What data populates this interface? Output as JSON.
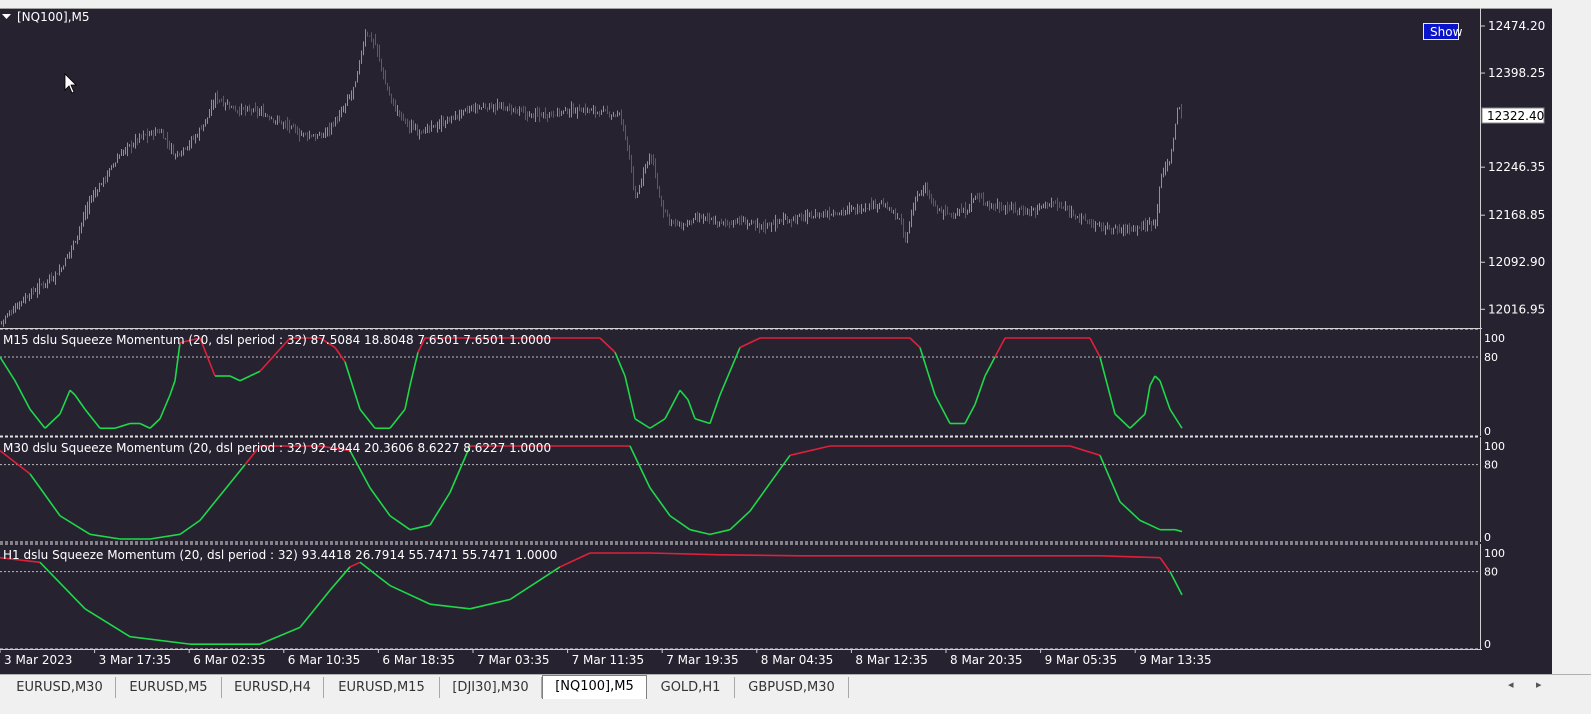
{
  "chart": {
    "symbol_label": "[NQ100],M5",
    "show_button_label": "Show",
    "current_price_label": "12322.40",
    "colors": {
      "background": "#262230",
      "bull": "#1ed94a",
      "bear": "#e0203a",
      "grid_dash": "#c8c8c8",
      "text": "#ffffff"
    },
    "price_axis_labels": [
      "12474.20",
      "12398.25",
      "12246.35",
      "12168.85",
      "12092.90",
      "12016.95"
    ],
    "time_axis_labels": [
      "3 Mar 2023",
      "3 Mar 17:35",
      "6 Mar 02:35",
      "6 Mar 10:35",
      "6 Mar 18:35",
      "7 Mar 03:35",
      "7 Mar 11:35",
      "7 Mar 19:35",
      "8 Mar 04:35",
      "8 Mar 12:35",
      "8 Mar 20:35",
      "9 Mar 05:35",
      "9 Mar 13:35"
    ]
  },
  "indicators": [
    {
      "label": "M15 dslu Squeeze Momentum (20, dsl period : 32) 87.5084 18.8048 7.6501 7.6501 1.0000",
      "levels": [
        "100",
        "80",
        "0"
      ]
    },
    {
      "label": "M30 dslu Squeeze Momentum (20, dsl period : 32) 92.4944 20.3606 8.6227 8.6227 1.0000",
      "levels": [
        "100",
        "80",
        "0"
      ]
    },
    {
      "label": "H1 dslu Squeeze Momentum (20, dsl period : 32) 93.4418 26.7914 55.7471 55.7471 1.0000",
      "levels": [
        "100",
        "80",
        "0"
      ]
    }
  ],
  "tabs": [
    "EURUSD,M30",
    "EURUSD,M5",
    "EURUSD,H4",
    "EURUSD,M15",
    "[DJI30],M30",
    "[NQ100],M5",
    "GOLD,H1",
    "GBPUSD,M30"
  ],
  "active_tab": "[NQ100],M5",
  "tab_nav": {
    "left": "◂",
    "right": "▸"
  },
  "chart_data": {
    "type": "line",
    "title": "[NQ100],M5",
    "x_labels": [
      "3 Mar 2023",
      "3 Mar 17:35",
      "6 Mar 02:35",
      "6 Mar 10:35",
      "6 Mar 18:35",
      "7 Mar 03:35",
      "7 Mar 11:35",
      "7 Mar 19:35",
      "8 Mar 04:35",
      "8 Mar 12:35",
      "8 Mar 20:35",
      "9 Mar 05:35",
      "9 Mar 13:35"
    ],
    "ylim": [
      11990,
      12500
    ],
    "price_series": {
      "name": "[NQ100],M5",
      "x": [
        0,
        20,
        40,
        60,
        75,
        90,
        105,
        120,
        140,
        160,
        175,
        195,
        210,
        215,
        235,
        260,
        285,
        300,
        320,
        340,
        355,
        365,
        375,
        385,
        395,
        410,
        425,
        445,
        470,
        490,
        510,
        530,
        560,
        580,
        600,
        620,
        630,
        634,
        640,
        650,
        660,
        670,
        680,
        700,
        720,
        740,
        760,
        780,
        800,
        820,
        840,
        860,
        880,
        900,
        905,
        915,
        925,
        935,
        950,
        965,
        975,
        990,
        1010,
        1030,
        1050,
        1070,
        1085,
        1100,
        1120,
        1140,
        1155,
        1160,
        1170,
        1178,
        1182
      ],
      "values": [
        11995,
        12030,
        12055,
        12080,
        12130,
        12195,
        12230,
        12268,
        12295,
        12305,
        12265,
        12295,
        12335,
        12360,
        12340,
        12335,
        12315,
        12300,
        12295,
        12330,
        12380,
        12465,
        12445,
        12380,
        12340,
        12310,
        12305,
        12320,
        12340,
        12345,
        12340,
        12330,
        12335,
        12340,
        12335,
        12330,
        12260,
        12190,
        12220,
        12270,
        12190,
        12160,
        12150,
        12165,
        12155,
        12160,
        12150,
        12160,
        12165,
        12170,
        12175,
        12180,
        12190,
        12160,
        12125,
        12200,
        12210,
        12180,
        12170,
        12175,
        12200,
        12185,
        12180,
        12175,
        12190,
        12175,
        12160,
        12150,
        12145,
        12150,
        12160,
        12230,
        12260,
        12350,
        12322
      ]
    },
    "series": [
      {
        "name": "M15",
        "ylim": [
          0,
          100
        ],
        "x": [
          0,
          15,
          30,
          45,
          60,
          70,
          75,
          85,
          100,
          115,
          130,
          140,
          150,
          160,
          170,
          175,
          180,
          200,
          215,
          230,
          240,
          250,
          260,
          290,
          320,
          335,
          345,
          360,
          375,
          390,
          405,
          410,
          418,
          425,
          440,
          480,
          520,
          560,
          600,
          615,
          625,
          635,
          650,
          665,
          680,
          688,
          695,
          710,
          720,
          728,
          740,
          760,
          800,
          840,
          880,
          910,
          920,
          935,
          950,
          965,
          975,
          985,
          995,
          1005,
          1050,
          1090,
          1100,
          1115,
          1130,
          1145,
          1150,
          1155,
          1160,
          1170,
          1182
        ],
        "values": [
          80,
          55,
          25,
          5,
          20,
          45,
          40,
          25,
          5,
          5,
          10,
          10,
          5,
          15,
          40,
          55,
          95,
          100,
          60,
          60,
          55,
          60,
          65,
          100,
          100,
          90,
          75,
          25,
          5,
          5,
          25,
          50,
          85,
          100,
          100,
          100,
          100,
          100,
          100,
          85,
          60,
          15,
          5,
          15,
          45,
          35,
          15,
          10,
          40,
          60,
          90,
          100,
          100,
          100,
          100,
          100,
          90,
          40,
          10,
          10,
          30,
          60,
          80,
          100,
          100,
          100,
          80,
          20,
          5,
          20,
          50,
          60,
          55,
          25,
          5
        ]
      },
      {
        "name": "M30",
        "ylim": [
          0,
          100
        ],
        "x": [
          0,
          30,
          60,
          90,
          120,
          150,
          180,
          200,
          215,
          230,
          245,
          260,
          290,
          320,
          350,
          370,
          390,
          410,
          430,
          450,
          470,
          500,
          540,
          580,
          630,
          650,
          670,
          690,
          710,
          730,
          750,
          770,
          790,
          830,
          870,
          910,
          950,
          990,
          1030,
          1070,
          1100,
          1120,
          1140,
          1160,
          1175,
          1182
        ],
        "values": [
          95,
          70,
          25,
          5,
          0,
          0,
          5,
          20,
          40,
          60,
          80,
          100,
          100,
          100,
          95,
          55,
          25,
          10,
          15,
          50,
          100,
          100,
          100,
          100,
          100,
          55,
          25,
          10,
          5,
          10,
          30,
          60,
          90,
          100,
          100,
          100,
          100,
          100,
          100,
          100,
          90,
          40,
          20,
          10,
          10,
          8
        ]
      },
      {
        "name": "H1",
        "ylim": [
          0,
          100
        ],
        "x": [
          0,
          40,
          85,
          130,
          190,
          260,
          300,
          330,
          350,
          360,
          390,
          430,
          470,
          510,
          560,
          590,
          650,
          720,
          800,
          900,
          1000,
          1100,
          1160,
          1170,
          1182
        ],
        "values": [
          95,
          90,
          40,
          10,
          2,
          2,
          20,
          60,
          85,
          90,
          65,
          45,
          40,
          50,
          85,
          100,
          100,
          98,
          97,
          97,
          97,
          97,
          95,
          80,
          55
        ]
      }
    ]
  }
}
